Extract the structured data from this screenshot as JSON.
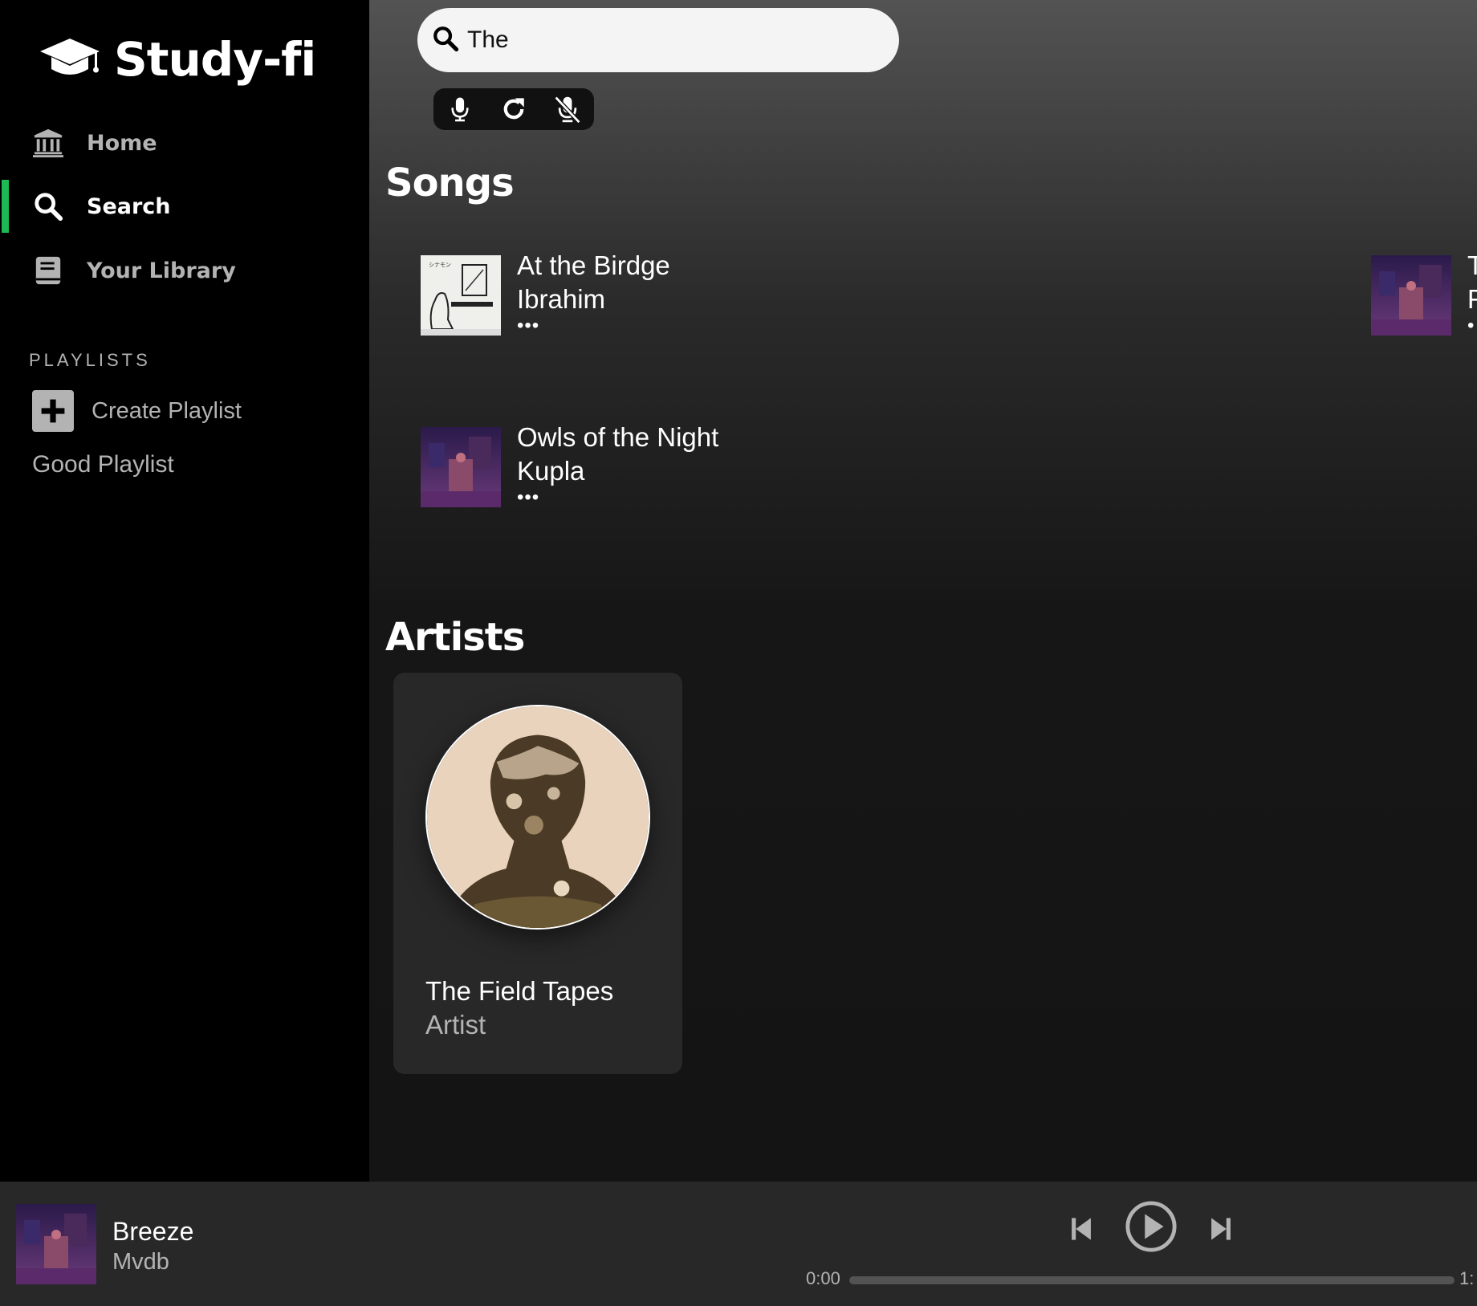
{
  "app": {
    "name": "Study-fi"
  },
  "sidebar": {
    "nav": [
      {
        "label": "Home",
        "icon": "bank-icon",
        "active": false
      },
      {
        "label": "Search",
        "icon": "search-icon",
        "active": true
      },
      {
        "label": "Your Library",
        "icon": "book-icon",
        "active": false
      }
    ],
    "playlists_heading": "PLAYLISTS",
    "create_playlist_label": "Create Playlist",
    "playlists": [
      "Good Playlist"
    ]
  },
  "search": {
    "value": "The",
    "voice_controls": [
      "microphone-icon",
      "refresh-icon",
      "microphone-off-icon"
    ]
  },
  "songs": {
    "heading": "Songs",
    "items": [
      {
        "title": "At the Birdge",
        "artist": "Ibrahim",
        "more": "•••"
      },
      {
        "title": "Owls of the Night",
        "artist": "Kupla",
        "more": "•••"
      },
      {
        "title": "T",
        "artist": "F",
        "more": "•"
      }
    ]
  },
  "artists": {
    "heading": "Artists",
    "items": [
      {
        "name": "The Field Tapes",
        "type": "Artist"
      }
    ]
  },
  "player": {
    "title": "Breeze",
    "artist": "Mvdb",
    "elapsed": "0:00",
    "duration": "1:",
    "progress": 0,
    "controls": [
      "skip-back-icon",
      "play-icon",
      "skip-forward-icon"
    ]
  },
  "colors": {
    "accent": "#1db954",
    "sidebar_bg": "#000000",
    "player_bg": "#282828",
    "card_bg": "#282828"
  }
}
